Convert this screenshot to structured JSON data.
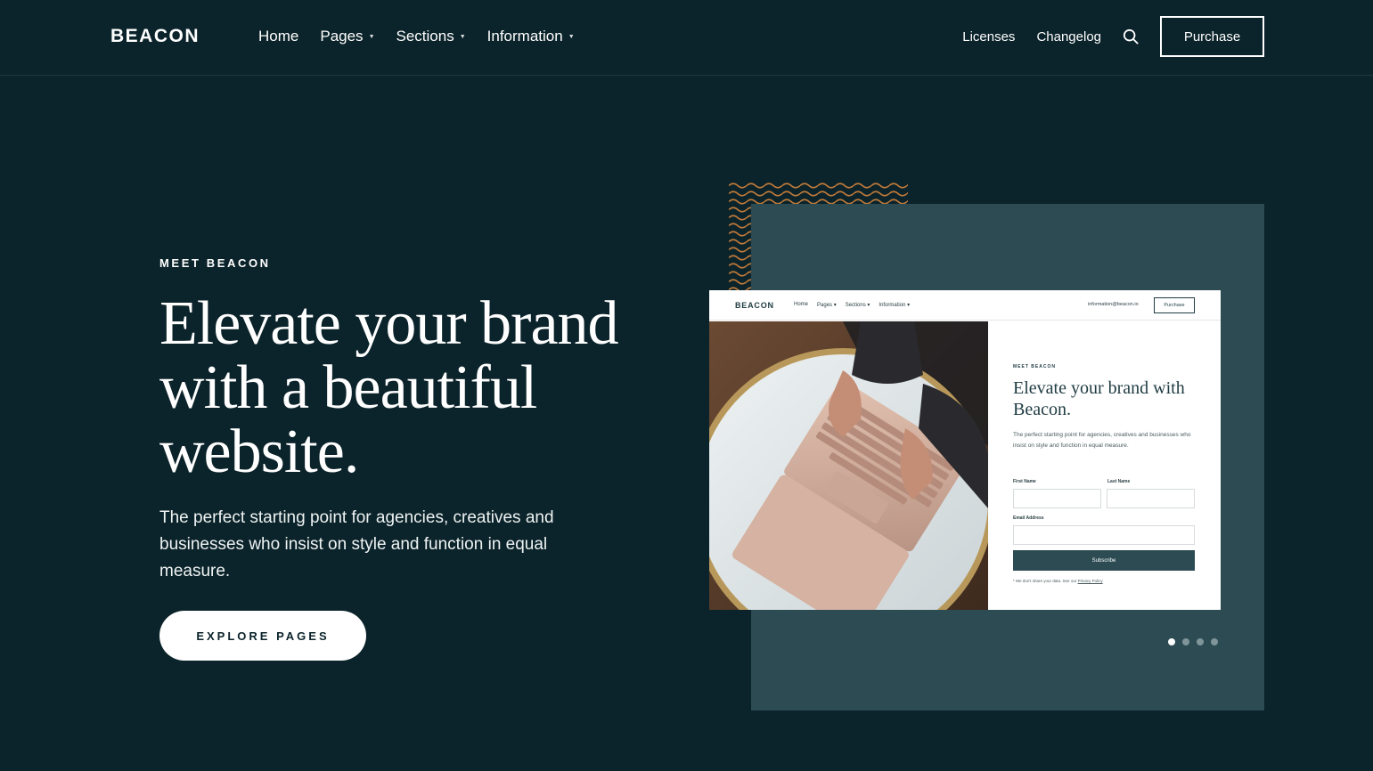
{
  "nav": {
    "logo": "BEACON",
    "menu": [
      {
        "label": "Home",
        "has_caret": false
      },
      {
        "label": "Pages",
        "has_caret": true
      },
      {
        "label": "Sections",
        "has_caret": true
      },
      {
        "label": "Information",
        "has_caret": true
      }
    ],
    "links": [
      "Licenses",
      "Changelog"
    ],
    "search_icon": "search-icon",
    "purchase_label": "Purchase"
  },
  "hero": {
    "eyebrow": "MEET BEACON",
    "headline": "Elevate your brand with a beautiful website.",
    "lead": "The perfect starting point for agencies, creatives and businesses who insist on style and function in equal measure.",
    "cta_label": "EXPLORE PAGES"
  },
  "preview": {
    "logo": "BEACON",
    "menu": [
      "Home",
      "Pages ▾",
      "Sections ▾",
      "Information ▾"
    ],
    "email": "information@beacon.io",
    "purchase_label": "Purchase",
    "eyebrow": "MEET BEACON",
    "title": "Elevate your brand with Beacon.",
    "text": "The perfect starting point for agencies, creatives and businesses who insist on style and function in equal measure.",
    "first_name_label": "First Name",
    "last_name_label": "Last Name",
    "email_label": "Email Address",
    "subscribe_label": "Subscribe",
    "note_text": "* We don't share your data. See our ",
    "note_link": "Privacy Policy"
  },
  "carousel": {
    "total": 4,
    "active": 0
  },
  "colors": {
    "background": "#0b232a",
    "panel": "#2c4b53",
    "accent_wave": "#c07a3a"
  }
}
